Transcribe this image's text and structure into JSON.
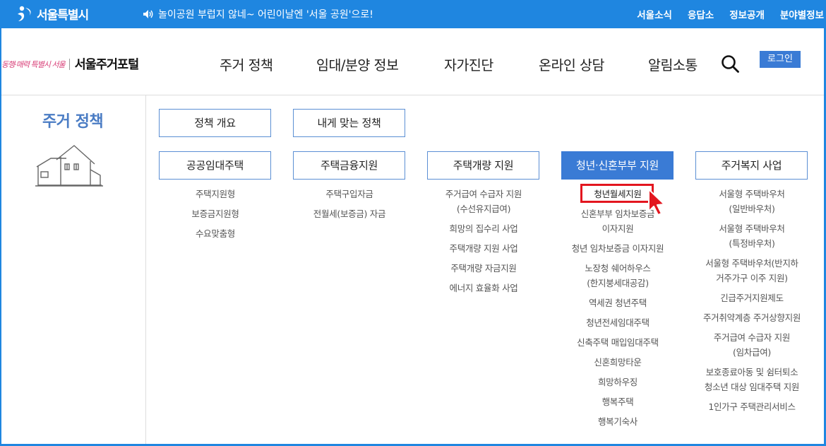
{
  "topbar": {
    "logo_text": "서울특별시",
    "notice": "놀이공원 부럽지 않네~ 어린이날엔 '서울 공원'으로!",
    "links": [
      "서울소식",
      "응답소",
      "정보공개",
      "분야별정보"
    ]
  },
  "header": {
    "slogan": "동행·매력 특별시 서울",
    "portal_name": "서울주거포털",
    "nav": [
      "주거 정책",
      "임대/분양 정보",
      "자가진단",
      "온라인 상담",
      "알림소통"
    ],
    "login_label": "로그인"
  },
  "sidebar": {
    "title": "주거 정책"
  },
  "menu": {
    "top_buttons": [
      "정책 개요",
      "내게 맞는 정책"
    ],
    "columns": [
      {
        "label": "공공임대주택",
        "items": [
          "주택지원형",
          "보증금지원형",
          "수요맞춤형"
        ]
      },
      {
        "label": "주택금융지원",
        "items": [
          "주택구입자금",
          "전월세(보증금) 자금"
        ]
      },
      {
        "label": "주택개량 지원",
        "items": [
          "주거급여 수급자 지원\n(수선유지급여)",
          "희망의 집수리 사업",
          "주택개량 지원 사업",
          "주택개량 자금지원",
          "에너지 효율화 사업"
        ]
      },
      {
        "label": "청년·신혼부부 지원",
        "active": true,
        "items": [
          "청년월세지원",
          "신혼부부 임차보증금\n이자지원",
          "청년 임차보증금 이자지원",
          "노장청 쉐어하우스\n(한지붕세대공감)",
          "역세권 청년주택",
          "청년전세임대주택",
          "신축주택 매입임대주택",
          "신혼희망타운",
          "희망하우징",
          "행복주택",
          "행복기숙사"
        ]
      },
      {
        "label": "주거복지 사업",
        "items": [
          "서울형 주택바우처\n(일반바우처)",
          "서울형 주택바우처\n(특정바우처)",
          "서울형 주택바우처(반지하\n거주가구 이주 지원)",
          "긴급주거지원제도",
          "주거취약계층 주거상향지원",
          "주거급여 수급자 지원\n(임차급여)",
          "보호종료아동 및 쉼터퇴소\n청소년 대상 임대주택 지원",
          "1인가구 주택관리서비스"
        ]
      }
    ]
  },
  "colors": {
    "primary": "#1f86e0",
    "button_border": "#5b8fd4",
    "active": "#3a7bd5",
    "highlight": "#e3161f",
    "sidebar_title": "#4a7cc4"
  }
}
